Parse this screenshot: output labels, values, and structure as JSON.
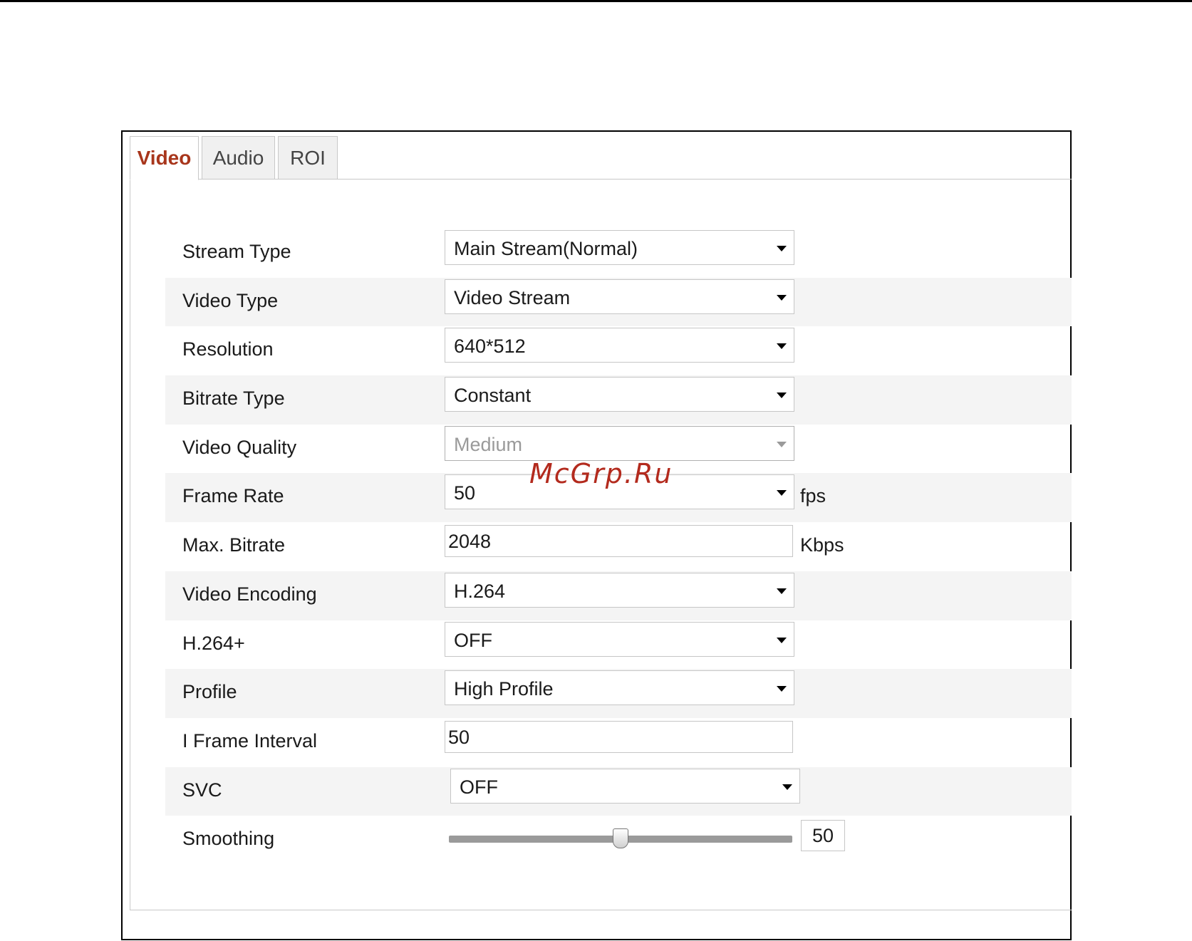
{
  "tabs": [
    {
      "label": "Video",
      "active": true
    },
    {
      "label": "Audio",
      "active": false
    },
    {
      "label": "ROI",
      "active": false
    }
  ],
  "fields": {
    "stream_type": {
      "label": "Stream Type",
      "value": "Main Stream(Normal)"
    },
    "video_type": {
      "label": "Video Type",
      "value": "Video Stream"
    },
    "resolution": {
      "label": "Resolution",
      "value": "640*512"
    },
    "bitrate_type": {
      "label": "Bitrate Type",
      "value": "Constant"
    },
    "video_quality": {
      "label": "Video Quality",
      "value": "Medium",
      "disabled": true
    },
    "frame_rate": {
      "label": "Frame Rate",
      "value": "50",
      "unit": "fps"
    },
    "max_bitrate": {
      "label": "Max. Bitrate",
      "value": "2048",
      "unit": "Kbps"
    },
    "video_encoding": {
      "label": "Video Encoding",
      "value": "H.264"
    },
    "h264_plus": {
      "label": "H.264+",
      "value": "OFF"
    },
    "profile": {
      "label": "Profile",
      "value": "High Profile"
    },
    "i_frame_interval": {
      "label": "I Frame Interval",
      "value": "50"
    },
    "svc": {
      "label": "SVC",
      "value": "OFF"
    },
    "smoothing": {
      "label": "Smoothing",
      "value": "50",
      "level_percent": 50
    }
  },
  "watermark": "McGrp.Ru",
  "colors": {
    "active_tab": "#a8361c",
    "row_shade": "#f4f4f4",
    "watermark": "#b32a1d"
  }
}
